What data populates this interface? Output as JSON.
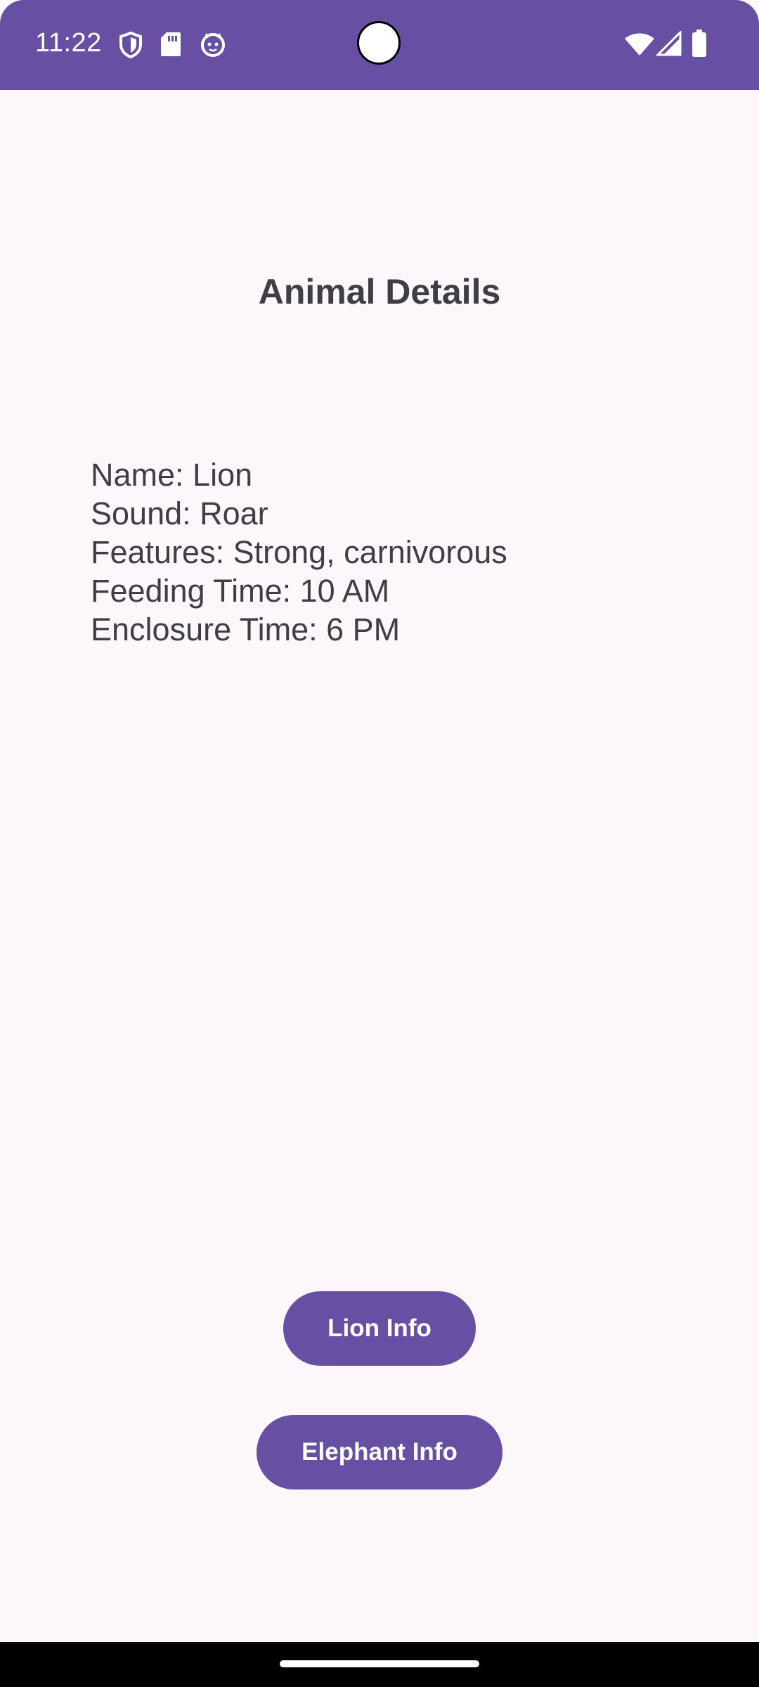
{
  "status_bar": {
    "time": "11:22",
    "background_color": "#6750A4",
    "left_icons": [
      "shield-icon",
      "sd-card-icon",
      "cat-face-icon"
    ],
    "right_icons": [
      "wifi-icon",
      "cellular-signal-icon",
      "battery-icon"
    ]
  },
  "screen": {
    "title": "Animal Details",
    "details": {
      "name": "Name: Lion",
      "sound": "Sound: Roar",
      "features": "Features: Strong, carnivorous",
      "feeding_time": "Feeding Time: 10 AM",
      "enclosure_time": "Enclosure Time: 6 PM"
    }
  },
  "buttons": {
    "lion_label": "Lion Info",
    "elephant_label": "Elephant Info",
    "color": "#6750A4"
  },
  "navigation": {
    "home_handle": "home-handle"
  }
}
